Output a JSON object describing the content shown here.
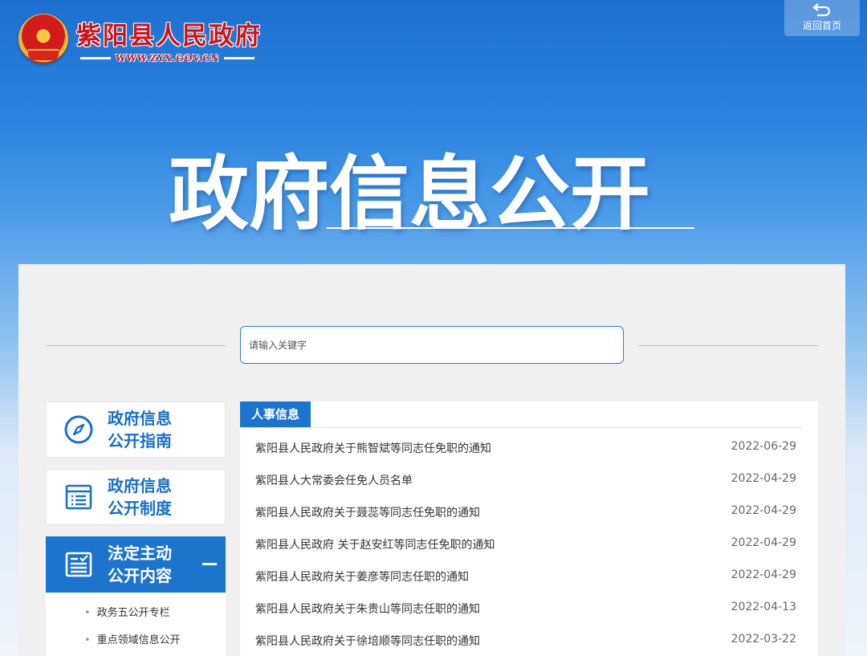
{
  "header": {
    "site_name": "紫阳县人民政府",
    "site_url": "WWW.ZYX.GOV.CN",
    "home_button_label": "返回首页",
    "page_title": "政府信息公开"
  },
  "search": {
    "placeholder": "请输入关键字"
  },
  "sidebar": {
    "items": [
      {
        "line1": "政府信息",
        "line2": "公开指南",
        "icon": "compass-icon"
      },
      {
        "line1": "政府信息",
        "line2": "公开制度",
        "icon": "document-list-icon"
      },
      {
        "line1": "法定主动",
        "line2": "公开内容",
        "icon": "checklist-icon",
        "active": true
      }
    ],
    "submenu": [
      "政务五公开专栏",
      "重点领域信息公开"
    ]
  },
  "news": {
    "tab_label": "人事信息",
    "rows": [
      {
        "title": "紫阳县人民政府关于熊智斌等同志任免职的通知",
        "date": "2022-06-29"
      },
      {
        "title": "紫阳县人大常委会任免人员名单",
        "date": "2022-04-29"
      },
      {
        "title": "紫阳县人民政府关于聂蕊等同志任免职的通知",
        "date": "2022-04-29"
      },
      {
        "title": "紫阳县人民政府 关于赵安红等同志任免职的通知",
        "date": "2022-04-29"
      },
      {
        "title": "紫阳县人民政府关于姜彦等同志任职的通知",
        "date": "2022-04-29"
      },
      {
        "title": "紫阳县人民政府关于朱贵山等同志任职的通知",
        "date": "2022-04-13"
      },
      {
        "title": "紫阳县人民政府关于徐培顺等同志任职的通知",
        "date": "2022-03-22"
      }
    ]
  },
  "colors": {
    "brand_red": "#c8161d",
    "accent_blue": "#1d74cc"
  }
}
